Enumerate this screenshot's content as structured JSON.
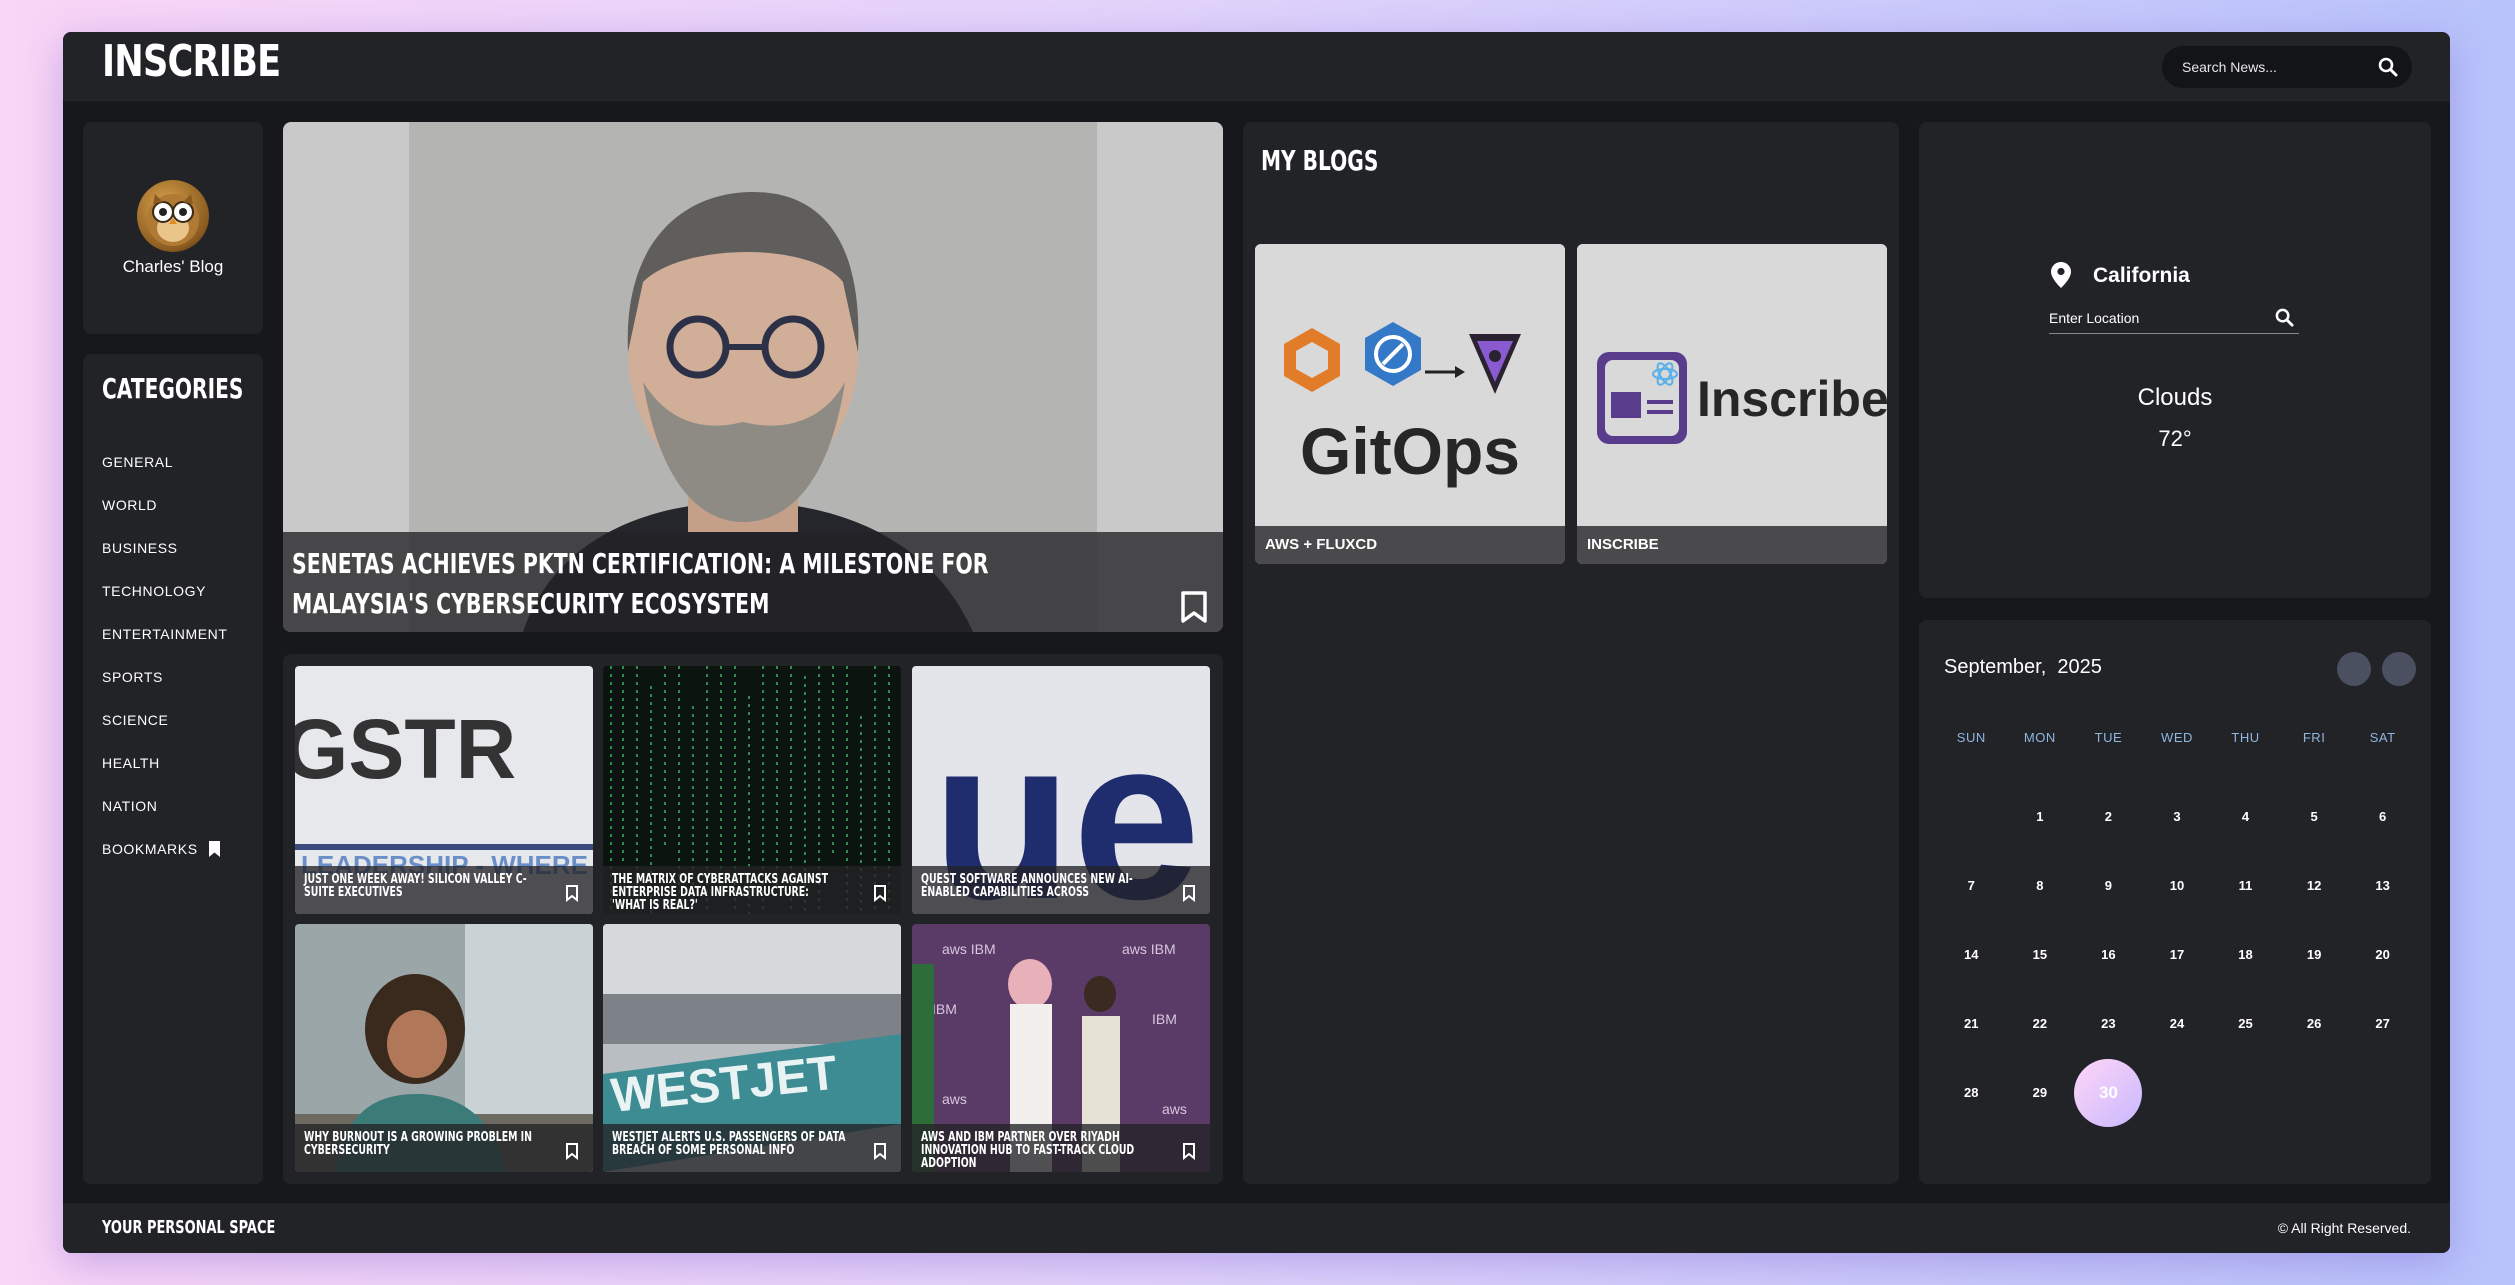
{
  "header": {
    "logo": "INSCRIBE",
    "search_placeholder": "Search News..."
  },
  "profile": {
    "name": "Charles' Blog"
  },
  "categories": {
    "title": "CATEGORIES",
    "items": [
      "GENERAL",
      "WORLD",
      "BUSINESS",
      "TECHNOLOGY",
      "ENTERTAINMENT",
      "SPORTS",
      "SCIENCE",
      "HEALTH",
      "NATION",
      "BOOKMARKS"
    ]
  },
  "hero": {
    "title": "Senetas achieves PKTN certification: A milestone for Malaysia's cybersecurity ecosystem"
  },
  "news": [
    {
      "title": "Just one week away! Silicon Valley C-Suite Executives",
      "image_text": "GSTR",
      "image_subtext": "LEADERSHIP - WHERE"
    },
    {
      "title": "The Matrix of Cyberattacks Against Enterprise Data Infrastructure: 'What is real?'"
    },
    {
      "title": "Quest Software Announces New AI-Enabled Capabilities Across",
      "image_text": "ue"
    },
    {
      "title": "Why Burnout Is a Growing Problem in Cybersecurity"
    },
    {
      "title": "WestJet alerts U.S. passengers of data breach of some personal info",
      "image_text": "WESTJET"
    },
    {
      "title": "AWS and IBM partner over Riyadh innovation hub to fast-track cloud adoption",
      "image_text": "aws IBM"
    }
  ],
  "blogs": {
    "title": "MY BLOGS",
    "items": [
      {
        "caption": "AWS + FLUXCD",
        "image_text": "GitOps"
      },
      {
        "caption": "INSCRIBE",
        "image_text": "Inscribe"
      }
    ]
  },
  "weather": {
    "city": "California",
    "input_placeholder": "Enter Location",
    "description": "Clouds",
    "temperature": "72°"
  },
  "calendar": {
    "month": "September,",
    "year": "2025",
    "weekdays": [
      "SUN",
      "MON",
      "TUE",
      "WED",
      "THU",
      "FRI",
      "SAT"
    ],
    "weeks": [
      [
        "",
        "1",
        "2",
        "3",
        "4",
        "5",
        "6"
      ],
      [
        "7",
        "8",
        "9",
        "10",
        "11",
        "12",
        "13"
      ],
      [
        "14",
        "15",
        "16",
        "17",
        "18",
        "19",
        "20"
      ],
      [
        "21",
        "22",
        "23",
        "24",
        "25",
        "26",
        "27"
      ],
      [
        "28",
        "29",
        "30",
        "",
        "",
        "",
        ""
      ]
    ],
    "today": "30"
  },
  "footer": {
    "left": "YOUR PERSONAL SPACE",
    "right": "© All Right Reserved."
  },
  "colors": {
    "background": "#17181b",
    "panel": "#222327",
    "accent_gradient_start": "#ffd6f6",
    "accent_gradient_end": "#c9b8ff",
    "weekday_text": "#8fb7e0"
  }
}
